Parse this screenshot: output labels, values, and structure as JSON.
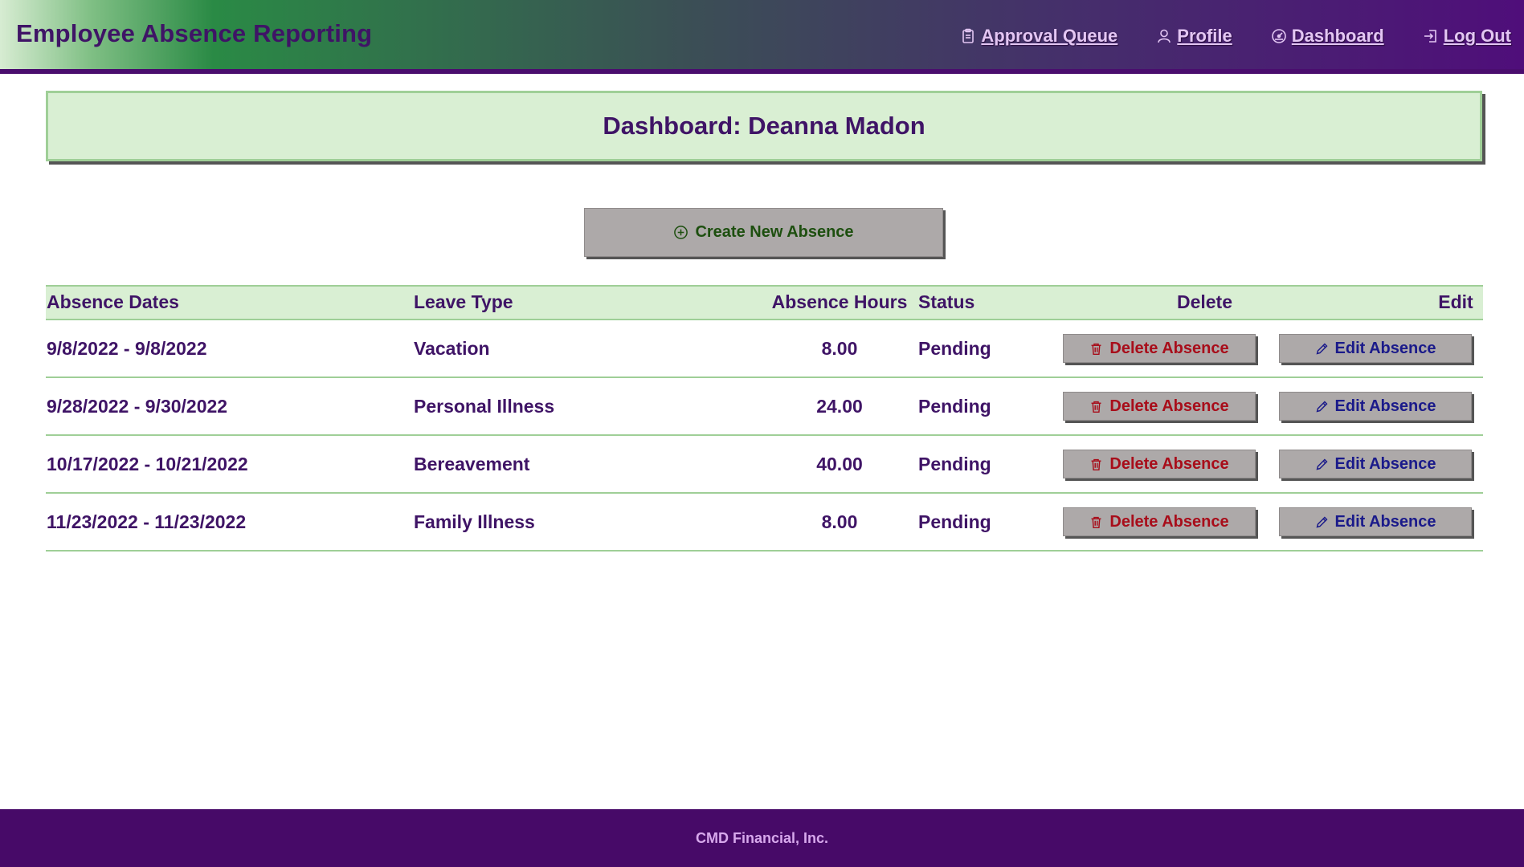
{
  "header": {
    "app_title": "Employee Absence Reporting",
    "nav": [
      {
        "label": "Approval Queue",
        "icon": "clipboard-icon"
      },
      {
        "label": "Profile",
        "icon": "user-icon"
      },
      {
        "label": "Dashboard",
        "icon": "dashboard-icon"
      },
      {
        "label": "Log Out",
        "icon": "logout-icon"
      }
    ]
  },
  "main": {
    "page_title": "Dashboard: Deanna Madon",
    "create_button_label": "Create New Absence",
    "table": {
      "columns": [
        "Absence Dates",
        "Leave Type",
        "Absence Hours",
        "Status",
        "Delete",
        "Edit"
      ],
      "rows": [
        {
          "dates": "9/8/2022 - 9/8/2022",
          "leave_type": "Vacation",
          "hours": "8.00",
          "status": "Pending",
          "delete_label": "Delete Absence",
          "edit_label": "Edit Absence"
        },
        {
          "dates": "9/28/2022 - 9/30/2022",
          "leave_type": "Personal Illness",
          "hours": "24.00",
          "status": "Pending",
          "delete_label": "Delete Absence",
          "edit_label": "Edit Absence"
        },
        {
          "dates": "10/17/2022 - 10/21/2022",
          "leave_type": "Bereavement",
          "hours": "40.00",
          "status": "Pending",
          "delete_label": "Delete Absence",
          "edit_label": "Edit Absence"
        },
        {
          "dates": "11/23/2022 - 11/23/2022",
          "leave_type": "Family Illness",
          "hours": "8.00",
          "status": "Pending",
          "delete_label": "Delete Absence",
          "edit_label": "Edit Absence"
        }
      ]
    }
  },
  "footer": {
    "text": "CMD Financial, Inc."
  },
  "colors": {
    "brand_purple": "#470a68",
    "title_purple": "#3f1466",
    "panel_green": "#d9efd3",
    "border_green": "#9fcf97",
    "button_gray": "#ada9a9",
    "delete_red": "#a80d1a",
    "edit_blue": "#1a1a8a",
    "create_green": "#1d4f0f"
  }
}
